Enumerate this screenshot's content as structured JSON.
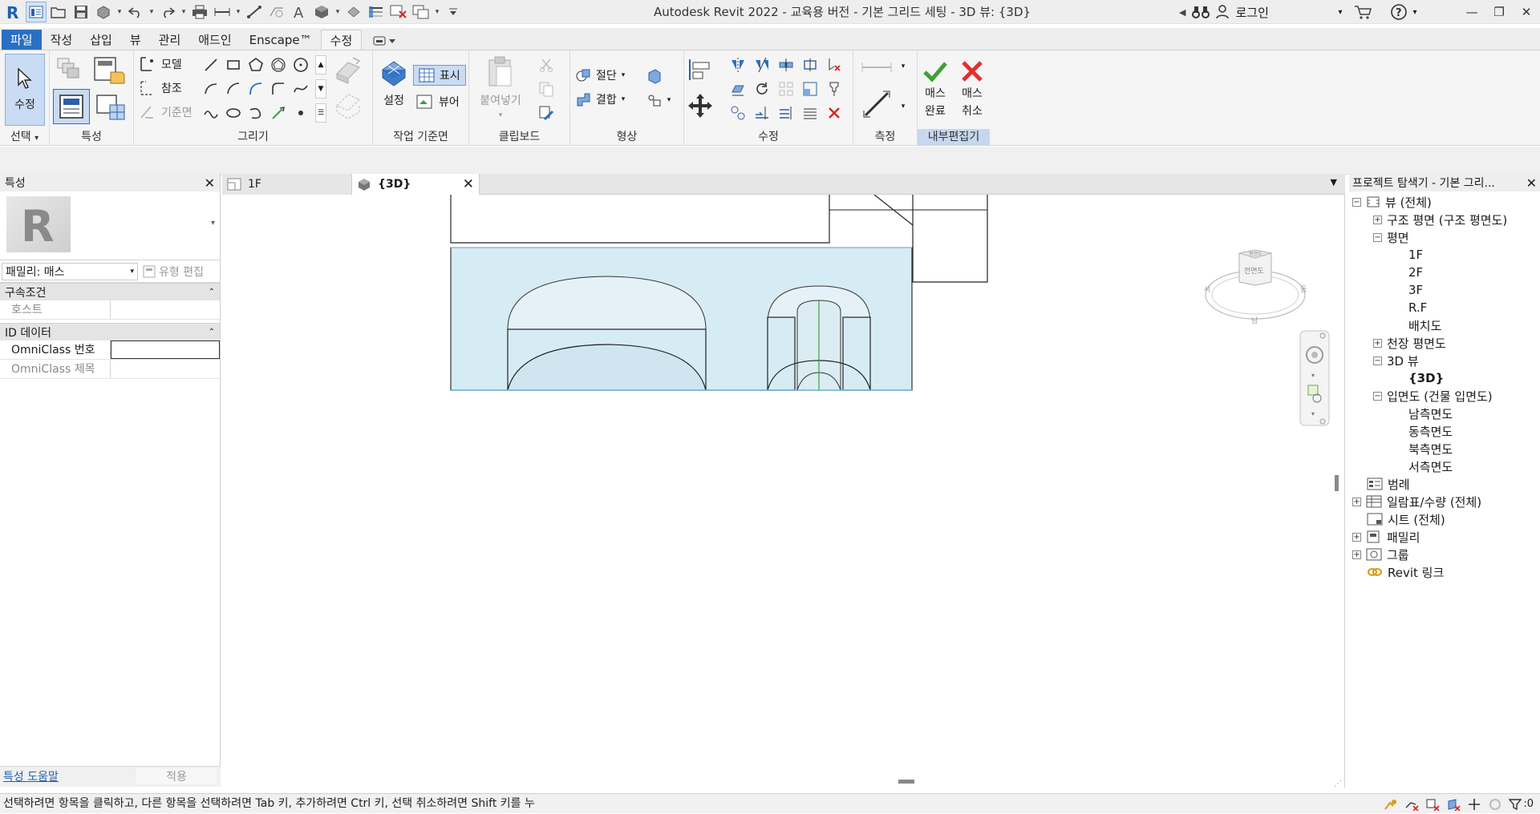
{
  "app": {
    "title": "Autodesk Revit 2022 - 교육용 버전 - 기본 그리드 세팅 - 3D 뷰: {3D}",
    "login_label": "로그인"
  },
  "quick_access": [
    "revit-logo",
    "home",
    "open",
    "save",
    "sync",
    "undo",
    "redo",
    "print",
    "measure",
    "dimension",
    "tag",
    "text",
    "3d-view",
    "section",
    "thin-lines",
    "close-hidden",
    "switch-windows",
    "customize"
  ],
  "ribbon_tabs": [
    {
      "label": "파일",
      "type": "file"
    },
    {
      "label": "작성"
    },
    {
      "label": "삽입"
    },
    {
      "label": "뷰"
    },
    {
      "label": "관리"
    },
    {
      "label": "애드인"
    },
    {
      "label": "Enscape™"
    },
    {
      "label": "수정",
      "active": true
    }
  ],
  "ribbon": {
    "select": {
      "modify_label": "수정",
      "panel_label": "선택"
    },
    "properties": {
      "panel_label": "특성"
    },
    "draw": {
      "model_label": "모델",
      "reference_label": "참조",
      "ref_plane_label": "기준면",
      "panel_label": "그리기"
    },
    "work_plane": {
      "set_label": "설정",
      "show_label": "표시",
      "viewer_label": "뷰어",
      "panel_label": "작업 기준면"
    },
    "clipboard": {
      "paste_label": "붙여넣기",
      "panel_label": "클립보드"
    },
    "geometry": {
      "cut_label": "절단",
      "join_label": "결합",
      "panel_label": "형상"
    },
    "modify": {
      "panel_label": "수정"
    },
    "measure": {
      "panel_label": "측정"
    },
    "in_place_editor": {
      "finish_label_1": "매스",
      "finish_label_2": "완료",
      "cancel_label_1": "매스",
      "cancel_label_2": "취소",
      "panel_label": "내부편집기"
    }
  },
  "properties": {
    "title": "특성",
    "family_label": "패밀리: 매스",
    "edit_type_label": "유형 편집",
    "sections": [
      {
        "title": "구속조건",
        "rows": [
          {
            "key": "호스트",
            "value": ""
          }
        ]
      },
      {
        "title": "ID 데이터",
        "rows": [
          {
            "key": "OmniClass 번호",
            "value": ""
          },
          {
            "key": "OmniClass 제목",
            "value": ""
          }
        ]
      }
    ],
    "help_link": "특성 도움말",
    "apply_label": "적용"
  },
  "view_tabs": [
    {
      "label": "1F",
      "icon": "floor-plan-icon",
      "active": false
    },
    {
      "label": "{3D}",
      "icon": "3d-view-icon",
      "active": true
    }
  ],
  "viewcube": {
    "face_label": "전면도",
    "top_label": "평면도",
    "left_label": "서",
    "right_label": "동",
    "bottom_label": "남"
  },
  "project_browser": {
    "title": "프로젝트 탐색기 - 기본 그리...",
    "nodes": [
      {
        "label": "뷰 (전체)",
        "level": 0,
        "expander": "−",
        "icon": "views-icon"
      },
      {
        "label": "구조 평면 (구조 평면도)",
        "level": 1,
        "expander": "+"
      },
      {
        "label": "평면",
        "level": 1,
        "expander": "−"
      },
      {
        "label": "1F",
        "level": 2
      },
      {
        "label": "2F",
        "level": 2
      },
      {
        "label": "3F",
        "level": 2
      },
      {
        "label": "R.F",
        "level": 2
      },
      {
        "label": "배치도",
        "level": 2
      },
      {
        "label": "천장 평면도",
        "level": 1,
        "expander": "+"
      },
      {
        "label": "3D 뷰",
        "level": 1,
        "expander": "−"
      },
      {
        "label": "{3D}",
        "level": 2,
        "bold": true
      },
      {
        "label": "입면도 (건물 입면도)",
        "level": 1,
        "expander": "−"
      },
      {
        "label": "남측면도",
        "level": 2
      },
      {
        "label": "동측면도",
        "level": 2
      },
      {
        "label": "북측면도",
        "level": 2
      },
      {
        "label": "서측면도",
        "level": 2
      },
      {
        "label": "범례",
        "level": 0,
        "icon": "legend-icon"
      },
      {
        "label": "일람표/수량 (전체)",
        "level": 0,
        "expander": "+",
        "icon": "schedule-icon"
      },
      {
        "label": "시트 (전체)",
        "level": 0,
        "icon": "sheet-icon"
      },
      {
        "label": "패밀리",
        "level": 0,
        "expander": "+",
        "icon": "family-icon"
      },
      {
        "label": "그룹",
        "level": 0,
        "expander": "+",
        "icon": "group-icon"
      },
      {
        "label": "Revit 링크",
        "level": 0,
        "icon": "revit-link-icon"
      }
    ]
  },
  "status": {
    "hint": "선택하려면 항목을 클릭하고, 다른 항목을 선택하려면 Tab 키, 추가하려면 Ctrl 키, 선택 취소하려면 Shift 키를 누",
    "filter_count": ":0"
  },
  "colors": {
    "file_tab": "#2b6fc4",
    "mass_fill": "#d6ecf5",
    "finish_green": "#3aa335",
    "cancel_red": "#e0302f",
    "highlight_panel": "#c6d7ef"
  }
}
